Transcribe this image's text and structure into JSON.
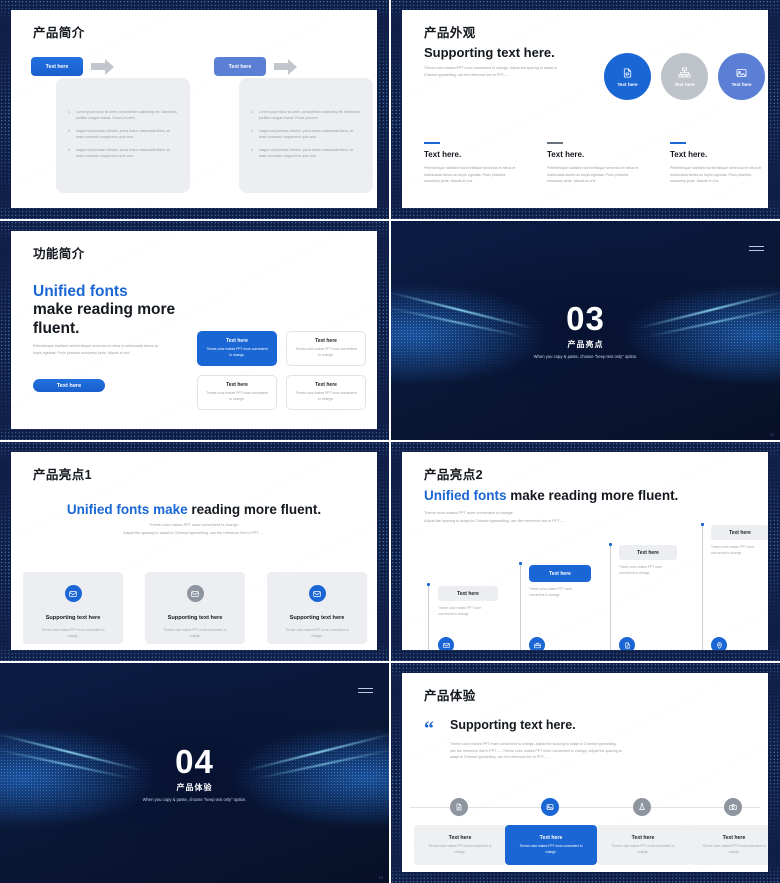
{
  "deck": {
    "watermark": "小牛办公",
    "accent_blue": "#1a66d4",
    "light_blue": "#5b7fd4",
    "gray": "#bec3ca",
    "frame_navy": "#101f47"
  },
  "slides": [
    {
      "id": "product-intro",
      "title": "产品简介",
      "page_number": "",
      "columns": [
        {
          "button_label": "Text here",
          "button_style": "primary",
          "items": [
            "Lorem ipsum dolor sit amet, consectetuer adipiscing elit. Maecenas porttitor congue massa. Fusce posuere.",
            "magna sed pulvinar ultricies, purus lectus malesuada libero, sit amet commodo magna eros quis urna.",
            "magna sed pulvinar ultricies, purus lectus malesuada libero, sit amet commodo magna eros quis urna."
          ],
          "numbers": [
            "1.",
            "2.",
            "3."
          ]
        },
        {
          "button_label": "Text here",
          "button_style": "secondary",
          "items": [
            "Lorem ipsum dolor sit amet, consectetuer adipiscing elit. Maecenas porttitor congue massa. Fusce posuere.",
            "magna sed pulvinar ultricies, purus lectus malesuada libero, sit amet commodo magna eros quis urna.",
            "magna sed pulvinar ultricies, purus lectus malesuada libero, sit amet commodo magna eros quis urna."
          ],
          "numbers": [
            "1.",
            "2.",
            "3."
          ]
        }
      ]
    },
    {
      "id": "product-appearance",
      "title": "产品外观",
      "headline": "Supporting text here.",
      "subtext": "Theme color makes PPT more convenient to change. Adjust the spacing to adapt to Chinese typesetting, use the reference line in PPT......",
      "circles": [
        {
          "label": "Text here",
          "icon": "document-icon",
          "color": "blue"
        },
        {
          "label": "Text here",
          "icon": "sitemap-icon",
          "color": "gray"
        },
        {
          "label": "Text here",
          "icon": "image-icon",
          "color": "periwinkle"
        }
      ],
      "columns": [
        {
          "heading": "Text here.",
          "body": "Pellentesque habitant morbi tristique senectus et netus et malesuada fames ac turpis egestas. Proin pharetra nonummy pede. Mauris et orci.",
          "rule": "blue"
        },
        {
          "heading": "Text here.",
          "body": "Pellentesque habitant morbi tristique senectus et netus et malesuada fames ac turpis egestas. Proin pharetra nonummy pede. Mauris et orci.",
          "rule": "gray"
        },
        {
          "heading": "Text here.",
          "body": "Pellentesque habitant morbi tristique senectus et netus et malesuada fames ac turpis egestas. Proin pharetra nonummy pede. Mauris et orci.",
          "rule": "blue"
        }
      ]
    },
    {
      "id": "feature-intro",
      "title": "功能简介",
      "headline_accent": "Unified fonts",
      "headline_rest": "make reading more fluent.",
      "body": "Pellentesque habitant morbi tristique senectus et netus et malesuada fames ac turpis egestas. Proin pharetra nonummy pede. Mauris et orci.",
      "cta_label": "Text here",
      "cards": [
        {
          "title": "Text here",
          "sub": "Theme color makes PPT more convenient to change.",
          "selected": true
        },
        {
          "title": "Text here",
          "sub": "Theme color makes PPT more convenient to change.",
          "selected": false
        },
        {
          "title": "Text here",
          "sub": "Theme color makes PPT more convenient to change.",
          "selected": false
        },
        {
          "title": "Text here",
          "sub": "Theme color makes PPT more convenient to change.",
          "selected": false
        }
      ]
    },
    {
      "id": "section-03",
      "number": "03",
      "subtitle": "产品亮点",
      "caption": "When you copy & paste, choose \"keep text only\" option.",
      "page_number": "11"
    },
    {
      "id": "product-highlight-1",
      "title": "产品亮点1",
      "headline_accent": "Unified fonts make",
      "headline_rest": "reading more fluent.",
      "sub1": "Theme color makes PPT more convenient to change.",
      "sub2": "Adjust the spacing to adapt to Chinese typesetting, use the reference line in PPT......",
      "features": [
        {
          "icon": "mail-icon",
          "color": "blue",
          "title": "Supporting text here",
          "sub": "Theme color makes PPT more convenient to change."
        },
        {
          "icon": "mail-icon",
          "color": "gray",
          "title": "Supporting text here",
          "sub": "Theme color makes PPT more convenient to change."
        },
        {
          "icon": "mail-icon",
          "color": "blue",
          "title": "Supporting text here",
          "sub": "Theme color makes PPT more convenient to change."
        }
      ]
    },
    {
      "id": "product-highlight-2",
      "title": "产品亮点2",
      "headline_accent": "Unified fonts",
      "headline_rest": "make reading more fluent.",
      "sub1": "Theme color makes PPT more convenient to change.",
      "sub2": "Adjust the spacing to adapt to Chinese typesetting, use the reference line in PPT......",
      "steps": [
        {
          "chip": "Text here",
          "selected": false,
          "text": "Theme color makes PPT more convenient to change.",
          "icon": "mail-icon"
        },
        {
          "chip": "Text here",
          "selected": true,
          "text": "Theme color makes PPT more convenient to change.",
          "icon": "briefcase-icon"
        },
        {
          "chip": "Text here",
          "selected": false,
          "text": "Theme color makes PPT more convenient to change.",
          "icon": "file-icon"
        },
        {
          "chip": "Text here",
          "selected": false,
          "text": "Theme color makes PPT more convenient to change.",
          "icon": "location-icon"
        }
      ]
    },
    {
      "id": "section-04",
      "number": "04",
      "subtitle": "产品体验",
      "caption": "When you copy & paste, choose \"keep text only\" option.",
      "page_number": "15"
    },
    {
      "id": "product-experience",
      "title": "产品体验",
      "headline": "Supporting text here.",
      "body": "Theme color makes PPT more convenient to change. Adjust the spacing to adapt to Chinese typesetting, use the reference line in PPT...... Theme color makes PPT more convenient to change. Adjust the spacing to adapt to Chinese typesetting, use the reference line in PPT......",
      "timeline": [
        {
          "icon": "file-icon",
          "color": "gray",
          "title": "Text here",
          "sub": "Theme color makes PPT more convenient to change.",
          "selected": false
        },
        {
          "icon": "image-icon",
          "color": "blue",
          "title": "Text here",
          "sub": "Theme color makes PPT more convenient to change.",
          "selected": true
        },
        {
          "icon": "flask-icon",
          "color": "gray",
          "title": "Text here",
          "sub": "Theme color makes PPT more convenient to change.",
          "selected": false
        },
        {
          "icon": "camera-icon",
          "color": "gray",
          "title": "Text here",
          "sub": "Theme color makes PPT more convenient to change.",
          "selected": false
        }
      ]
    }
  ]
}
